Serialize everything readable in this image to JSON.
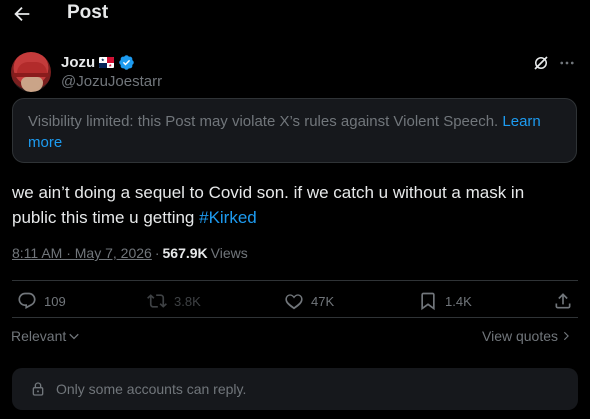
{
  "header": {
    "title": "Post",
    "back_icon": "arrow-left-icon"
  },
  "author": {
    "name": "Jozu",
    "flag_icon": "panama-flag-icon",
    "verified_icon": "verified-badge-icon",
    "handle": "@JozuJoestarr"
  },
  "notice": {
    "text": "Visibility limited: this Post may violate X’s rules against Violent Speech. ",
    "link": "Learn more"
  },
  "post": {
    "text_before": "we ain’t doing a sequel to Covid son. if we catch u without a mask in public this time u getting ",
    "hashtag": "#Kirked"
  },
  "meta": {
    "time": "8:11 AM · May 7, 2026",
    "separator": "·",
    "views_count": "567.9K",
    "views_label": "Views"
  },
  "actions": {
    "replies": "109",
    "reposts": "3.8K",
    "likes": "47K",
    "bookmarks": "1.4K"
  },
  "sort": {
    "label": "Relevant"
  },
  "quotes": {
    "label": "View quotes"
  },
  "reply_restriction": {
    "text": "Only some accounts can reply."
  },
  "colors": {
    "background": "#000000",
    "accent": "#1d9bf0",
    "muted": "#71767b",
    "text": "#e7e9ea",
    "card": "#16181c"
  }
}
